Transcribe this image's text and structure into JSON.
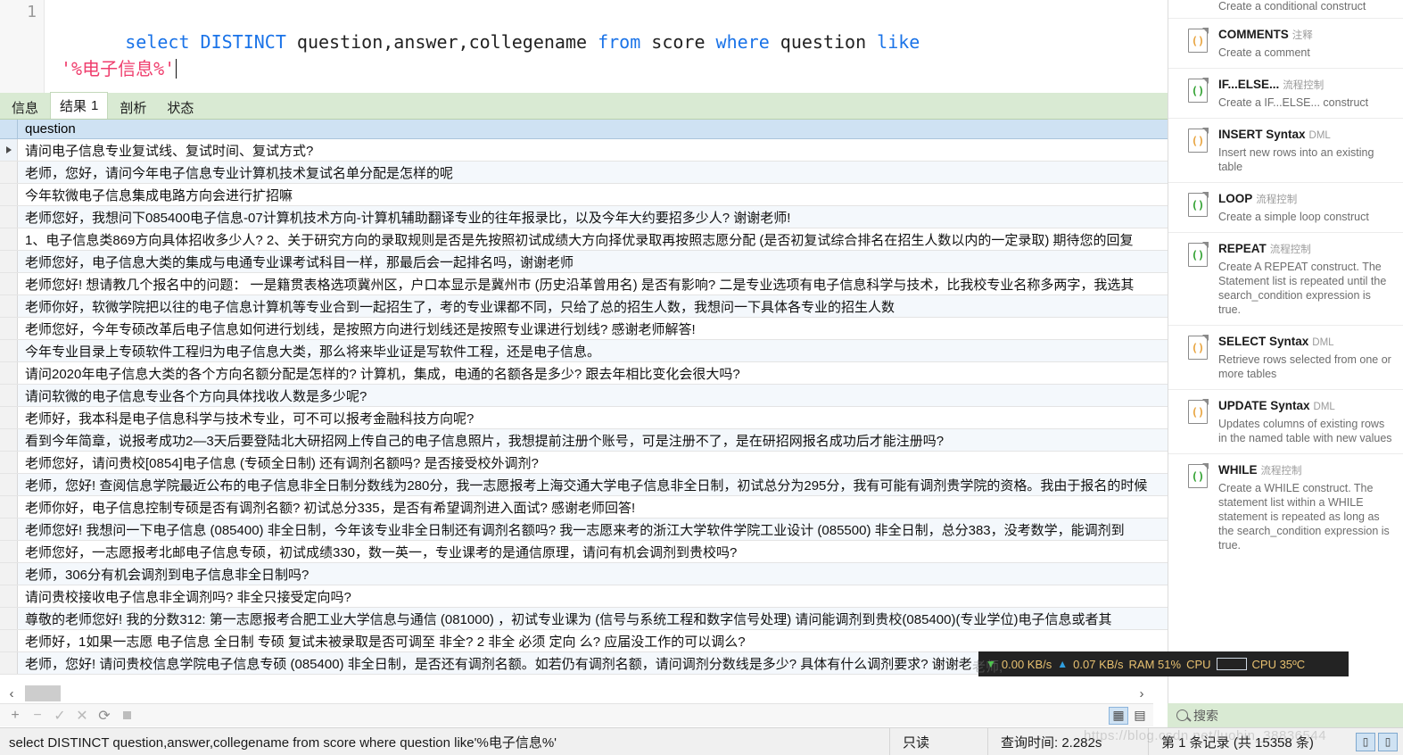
{
  "editor": {
    "line_number": "1",
    "sql_parts": [
      {
        "text": "select ",
        "kind": "kw"
      },
      {
        "text": "DISTINCT ",
        "kind": "kw"
      },
      {
        "text": "question,answer,collegename ",
        "kind": "plain"
      },
      {
        "text": "from ",
        "kind": "kw"
      },
      {
        "text": "score ",
        "kind": "plain"
      },
      {
        "text": "where ",
        "kind": "kw"
      },
      {
        "text": "question ",
        "kind": "plain"
      },
      {
        "text": "like",
        "kind": "kw"
      },
      {
        "text": "\n'%电子信息%'",
        "kind": "str"
      }
    ],
    "full_sql": "select DISTINCT question,answer,collegename from score where question like'%电子信息%'"
  },
  "tabs": [
    {
      "label": "信息",
      "badge": "",
      "active": false
    },
    {
      "label": "结果",
      "badge": "1",
      "active": true
    },
    {
      "label": "剖析",
      "badge": "",
      "active": false
    },
    {
      "label": "状态",
      "badge": "",
      "active": false
    }
  ],
  "grid": {
    "column": "question",
    "rows": [
      "请问电子信息专业复试线、复试时间、复试方式?",
      "老师，您好，请问今年电子信息专业计算机技术复试名单分配是怎样的呢",
      "今年软微电子信息集成电路方向会进行扩招嘛",
      "老师您好，我想问下085400电子信息-07计算机技术方向-计算机辅助翻译专业的往年报录比，以及今年大约要招多少人? 谢谢老师!",
      "1、电子信息类869方向具体招收多少人? 2、关于研究方向的录取规则是否是先按照初试成绩大方向择优录取再按照志愿分配 (是否初复试综合排名在招生人数以内的一定录取)  期待您的回复",
      "老师您好，电子信息大类的集成与电通专业课考试科目一样，那最后会一起排名吗，谢谢老师",
      "老师您好! 想请教几个报名中的问题： 一是籍贯表格选项冀州区，户口本显示是冀州市 (历史沿革曾用名) 是否有影响?  二是专业选项有电子信息科学与技术，比我校专业名称多两字，我选其",
      "老师你好，软微学院把以往的电子信息计算机等专业合到一起招生了，考的专业课都不同，只给了总的招生人数，我想问一下具体各专业的招生人数",
      "老师您好，今年专硕改革后电子信息如何进行划线，是按照方向进行划线还是按照专业课进行划线? 感谢老师解答!",
      "今年专业目录上专硕软件工程归为电子信息大类，那么将来毕业证是写软件工程，还是电子信息。",
      "请问2020年电子信息大类的各个方向名额分配是怎样的? 计算机，集成，电通的名额各是多少? 跟去年相比变化会很大吗?",
      "请问软微的电子信息专业各个方向具体找收人数是多少呢?",
      "老师好，我本科是电子信息科学与技术专业，可不可以报考金融科技方向呢?",
      "看到今年简章，说报考成功2—3天后要登陆北大研招网上传自己的电子信息照片，我想提前注册个账号，可是注册不了，是在研招网报名成功后才能注册吗?",
      "老师您好，请问贵校[0854]电子信息 (专硕全日制) 还有调剂名额吗? 是否接受校外调剂?",
      "老师，您好! 查阅信息学院最近公布的电子信息非全日制分数线为280分，我一志愿报考上海交通大学电子信息非全日制，初试总分为295分，我有可能有调剂贵学院的资格。我由于报名的时候",
      "老师你好，电子信息控制专硕是否有调剂名额? 初试总分335，是否有希望调剂进入面试? 感谢老师回答!",
      "老师您好! 我想问一下电子信息 (085400) 非全日制，今年该专业非全日制还有调剂名额吗? 我一志愿来考的浙江大学软件学院工业设计 (085500) 非全日制，总分383，没考数学，能调剂到",
      "老师您好，一志愿报考北邮电子信息专硕，初试成绩330，数一英一，专业课考的是通信原理，请问有机会调剂到贵校吗?",
      "老师，306分有机会调剂到电子信息非全日制吗?",
      "请问贵校接收电子信息非全调剂吗? 非全只接受定向吗?",
      "尊敬的老师您好! 我的分数312: 第一志愿报考合肥工业大学信息与通信 (081000) ，初试专业课为 (信号与系统工程和数字信号处理) 请问能调剂到贵校(085400)(专业学位)电子信息或者其",
      "老师好，1如果一志愿 电子信息 全日制 专硕 复试未被录取是否可调至 非全? 2 非全 必须 定向 么?  应届没工作的可以调么?",
      "老师，您好! 请问贵校信息学院电子信息专硕 (085400) 非全日制，是否还有调剂名额。如若仍有调剂名额，请问调剂分数线是多少? 具体有什么调剂要求? 谢谢老"
    ]
  },
  "bottom_nav": {
    "buttons": [
      "plus-icon",
      "minus-icon",
      "check-icon",
      "cross-icon",
      "refresh-icon",
      "stop-icon"
    ],
    "view_grid_label": "▦",
    "view_form_label": "▤"
  },
  "hscroll": {
    "left_label": "‹",
    "right_label": "›"
  },
  "snippets": {
    "partial_top_desc": "Create a conditional construct",
    "items": [
      {
        "title": "COMMENTS",
        "tag": "注释",
        "desc": "Create a comment",
        "icon_color": "#e8a33d"
      },
      {
        "title": "IF...ELSE...",
        "tag": "流程控制",
        "desc": "Create a IF...ELSE... construct",
        "icon_color": "#2ea02e"
      },
      {
        "title": "INSERT Syntax",
        "tag": "DML",
        "desc": "Insert new rows into an existing table",
        "icon_color": "#e8a33d"
      },
      {
        "title": "LOOP",
        "tag": "流程控制",
        "desc": "Create a simple loop construct",
        "icon_color": "#2ea02e"
      },
      {
        "title": "REPEAT",
        "tag": "流程控制",
        "desc": "Create A REPEAT construct. The Statement list is repeated until the search_condition expression is true.",
        "icon_color": "#2ea02e"
      },
      {
        "title": "SELECT Syntax",
        "tag": "DML",
        "desc": "Retrieve rows selected from one or more tables",
        "icon_color": "#e8a33d"
      },
      {
        "title": "UPDATE Syntax",
        "tag": "DML",
        "desc": "Updates columns of existing rows in the named table with new values",
        "icon_color": "#e8a33d"
      },
      {
        "title": "WHILE",
        "tag": "流程控制",
        "desc": "Create a WHILE construct. The statement list within a WHILE statement is repeated as long as the search_condition expression is true.",
        "icon_color": "#2ea02e"
      }
    ]
  },
  "search": {
    "placeholder": "搜索"
  },
  "statusbar": {
    "sql": "select DISTINCT question,answer,collegename from score where question like'%电子信息%'",
    "readonly": "只读",
    "query_time": "查询时间: 2.282s",
    "record_info": "第 1 条记录 (共 15358 条)"
  },
  "sysmon": {
    "down_speed": "0.00 KB/s",
    "up_speed": "0.07 KB/s",
    "ram": "RAM 51%",
    "cpu_label": "CPU",
    "cpu_temp": "CPU 35ºC"
  },
  "watermark": {
    "text": "https://blog.csdn.net/luobin_38836544",
    "overlay_text": "老师,"
  },
  "colors": {
    "tab_green": "#d9ead3",
    "header_blue": "#cfe2f3",
    "keyword_blue": "#1a73e8",
    "string_pink": "#ef3e6d"
  }
}
